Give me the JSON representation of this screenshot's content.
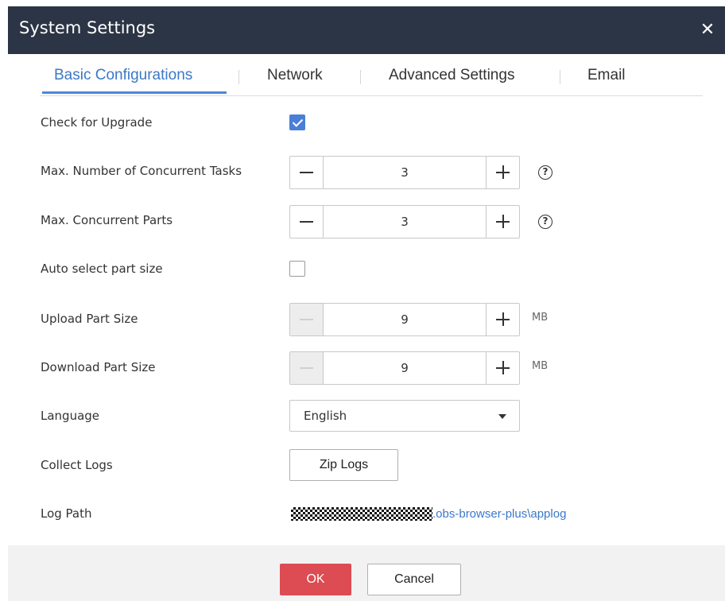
{
  "dialog": {
    "title": "System Settings",
    "close_icon": "close-icon"
  },
  "tabs": [
    {
      "label": "Basic Configurations",
      "active": true
    },
    {
      "label": "Network",
      "active": false
    },
    {
      "label": "Advanced Settings",
      "active": false
    },
    {
      "label": "Email",
      "active": false
    }
  ],
  "settings": {
    "check_upgrade": {
      "label": "Check for Upgrade",
      "checked": true
    },
    "max_tasks": {
      "label": "Max. Number of Concurrent Tasks",
      "value": "3",
      "help_icon": "help-icon",
      "help_glyph": "?"
    },
    "max_parts": {
      "label": "Max. Concurrent Parts",
      "value": "3",
      "help_icon": "help-icon",
      "help_glyph": "?"
    },
    "auto_part_size": {
      "label": "Auto select part size",
      "checked": false
    },
    "upload_part_size": {
      "label": "Upload Part Size",
      "value": "9",
      "unit": "MB",
      "minus_disabled": true
    },
    "download_part_size": {
      "label": "Download Part Size",
      "value": "9",
      "unit": "MB",
      "minus_disabled": true
    },
    "language": {
      "label": "Language",
      "selected": "English"
    },
    "collect_logs": {
      "label": "Collect Logs",
      "button_label": "Zip Logs"
    },
    "log_path": {
      "label": "Log Path",
      "path_visible": ".obs-browser-plus\\applog"
    }
  },
  "footer": {
    "ok_label": "OK",
    "cancel_label": "Cancel"
  },
  "colors": {
    "titlebar": "#2c3545",
    "accent": "#4a7fd9",
    "link": "#3c78c8",
    "ok_button": "#dc4c52"
  }
}
